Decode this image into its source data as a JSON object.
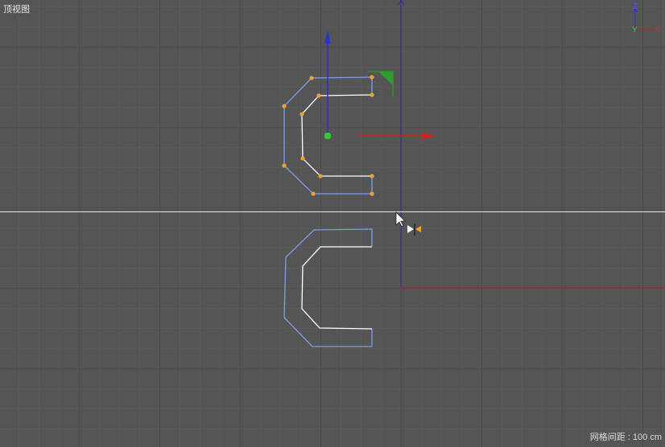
{
  "viewport": {
    "title": "顶视图",
    "grid_spacing": "网格间距 : 100 cm"
  },
  "axis_gizmo": {
    "z_label": "Z",
    "y_label": "Y",
    "x_label": "X"
  },
  "colors": {
    "background": "#555555",
    "spline": "#7f9fe0",
    "spline_highlight": "#ffffff",
    "point": "#f0a030",
    "axis_x": "#d02020",
    "axis_y": "#2e9c2e",
    "axis_z": "#2a32c8",
    "world_axis_x": "#b01e1e",
    "world_axis_z": "#2a2ab8",
    "mirror_line": "#e8e8e8"
  },
  "icons": [
    "mouse-cursor-icon",
    "symmetry-cursor-icon",
    "axis-gizmo-icon",
    "move-handle-icon"
  ]
}
